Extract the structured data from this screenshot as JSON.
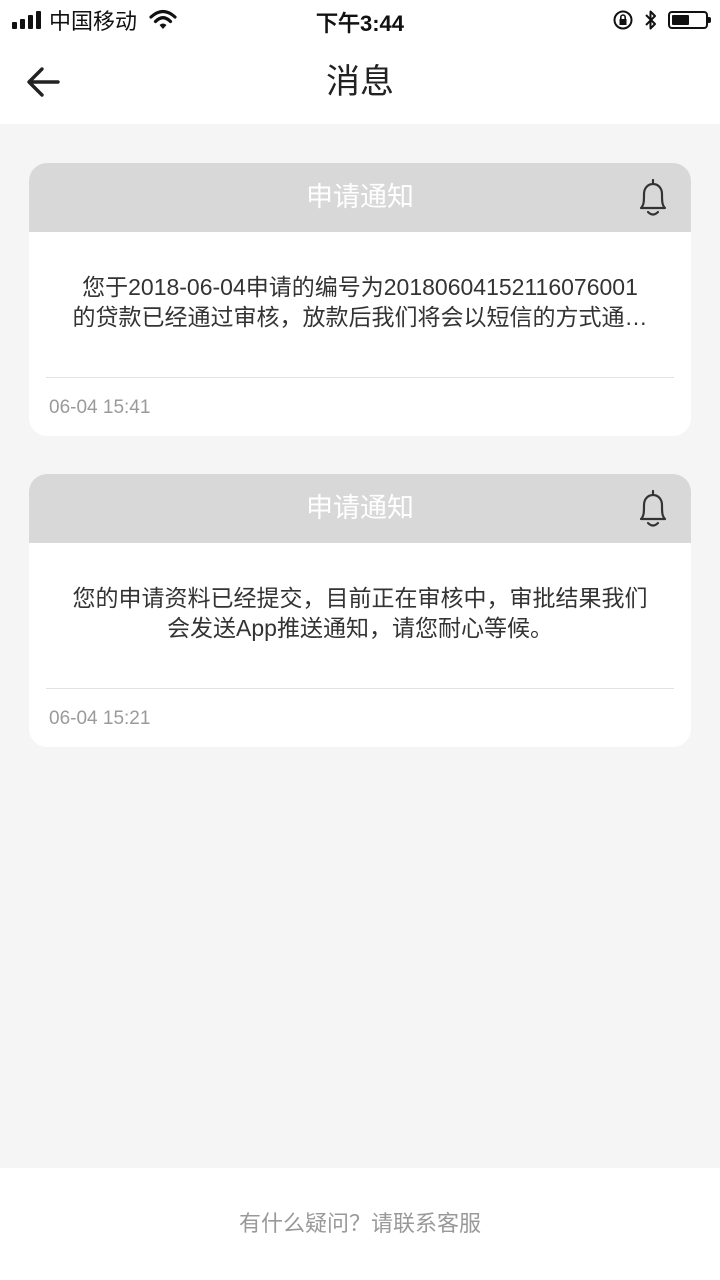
{
  "status_bar": {
    "carrier": "中国移动",
    "time": "下午3:44",
    "icons": [
      "signal-icon",
      "wifi-icon",
      "rotation-lock-icon",
      "bluetooth-icon",
      "battery-icon"
    ]
  },
  "nav": {
    "title": "消息",
    "back_icon": "back-arrow-icon"
  },
  "messages": [
    {
      "title": "申请通知",
      "body_line1": "您于2018-06-04申请的编号为20180604152116076001",
      "body_line2": "的贷款已经通过审核，放款后我们将会以短信的方式通…",
      "time": "06-04 15:41",
      "icon": "bell-icon"
    },
    {
      "title": "申请通知",
      "body_line1": "您的申请资料已经提交，目前正在审核中，审批结果我们",
      "body_line2": "会发送App推送通知，请您耐心等候。",
      "time": "06-04 15:21",
      "icon": "bell-icon"
    }
  ],
  "footer": {
    "text": "有什么疑问？请联系客服"
  },
  "colors": {
    "page_bg": "#f5f5f5",
    "card_header_bg": "#d8d8d8",
    "secondary_text": "#999999"
  }
}
